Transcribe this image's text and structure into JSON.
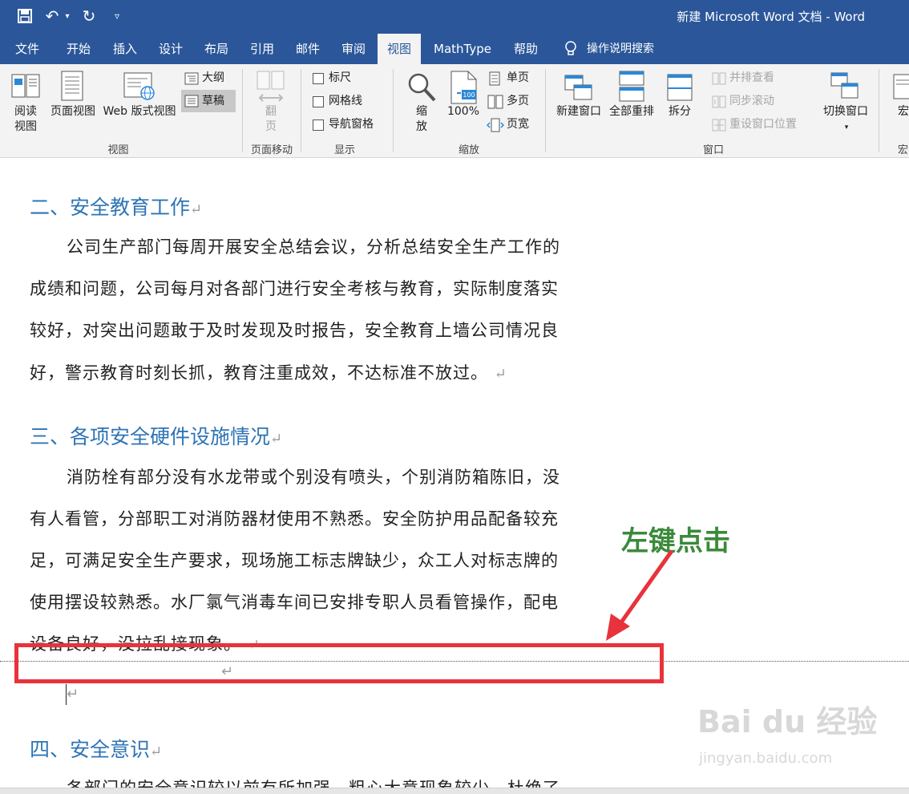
{
  "window": {
    "title": "新建 Microsoft Word 文档  -  Word"
  },
  "qat": {
    "save_glyph": "💾",
    "undo_glyph": "↶",
    "undo_arrow": "▾",
    "redo_glyph": "↻",
    "more_glyph": "▿"
  },
  "tabs": [
    "文件",
    "开始",
    "插入",
    "设计",
    "布局",
    "引用",
    "邮件",
    "审阅",
    "视图",
    "MathType",
    "帮助",
    "操作说明搜索"
  ],
  "ribbon": {
    "views": {
      "read": "阅读视图",
      "read_line1": "阅读",
      "read_line2": "视图",
      "print": "页面视图",
      "web": "Web 版式视图",
      "outline": "大纲",
      "draft": "草稿",
      "group": "视图"
    },
    "page_move": {
      "flip_line1": "翻",
      "flip_line2": "页",
      "group": "页面移动"
    },
    "show": {
      "ruler": "标尺",
      "gridlines": "网格线",
      "nav_pane": "导航窗格",
      "group": "显示"
    },
    "zoom": {
      "zoom_line1": "缩",
      "zoom_line2": "放",
      "pct": "100%",
      "pct_badge": "100",
      "one_page": "单页",
      "multi_page": "多页",
      "page_width": "页宽",
      "group": "缩放"
    },
    "window": {
      "new_window": "新建窗口",
      "arrange_all": "全部重排",
      "split": "拆分",
      "side_by_side": "并排查看",
      "sync_scroll": "同步滚动",
      "reset_pos": "重设窗口位置",
      "switch": "切换窗口",
      "switch_arrow": "▾",
      "group": "窗口"
    },
    "macro": {
      "label": "宏",
      "group": "宏"
    }
  },
  "document": {
    "h2": "二、安全教育工作",
    "p2": [
      "公司生产部门每周开展安全总结会议，分析总结安全生产工作的",
      "成绩和问题，公司每月对各部门进行安全考核与教育，实际制度落实",
      "较好，对突出问题敢于及时发现及时报告，安全教育上墙公司情况良",
      "好，警示教育时刻长抓，教育注重成效，不达标准不放过。"
    ],
    "h3": "三、各项安全硬件设施情况",
    "p3": [
      "消防栓有部分没有水龙带或个别没有喷头，个别消防箱陈旧，没",
      "有人看管，分部职工对消防器材使用不熟悉。安全防护用品配备较充",
      "足，可满足安全生产要求，现场施工标志牌缺少，众工人对标志牌的",
      "使用摆设较熟悉。水厂氯气消毒车间已安排专职人员看管操作，配电",
      "设备良好，没拉乱接现象。"
    ],
    "h4": "四、安全意识",
    "p4": "各部门的安全意识较以前有所加强，粗心大意现象较少，杜绝了",
    "para_mark": "↵",
    "annotation": "左键点击"
  },
  "watermark": {
    "line1": "Bai du 经验",
    "line2": "jingyan.baidu.com"
  },
  "colors": {
    "titlebar": "#2b579a",
    "heading": "#2e74b5",
    "annotation": "#3a8a3a",
    "highlight": "#e8323c"
  }
}
